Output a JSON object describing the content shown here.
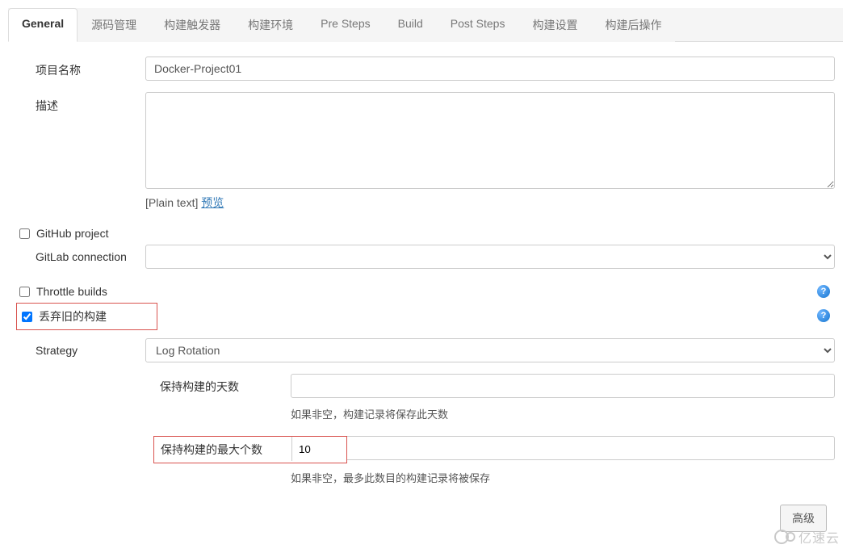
{
  "tabs": [
    {
      "label": "General",
      "active": true
    },
    {
      "label": "源码管理",
      "active": false
    },
    {
      "label": "构建触发器",
      "active": false
    },
    {
      "label": "构建环境",
      "active": false
    },
    {
      "label": "Pre Steps",
      "active": false
    },
    {
      "label": "Build",
      "active": false
    },
    {
      "label": "Post Steps",
      "active": false
    },
    {
      "label": "构建设置",
      "active": false
    },
    {
      "label": "构建后操作",
      "active": false
    }
  ],
  "form": {
    "project_name_label": "项目名称",
    "project_name_value": "Docker-Project01",
    "description_label": "描述",
    "description_value": "",
    "description_format": "[Plain text]",
    "description_preview": "预览",
    "github_project": {
      "label": "GitHub project",
      "checked": false
    },
    "gitlab_connection": {
      "label": "GitLab connection",
      "selected": ""
    },
    "throttle_builds": {
      "label": "Throttle builds",
      "checked": false
    },
    "discard_old_builds": {
      "label": "丢弃旧的构建",
      "checked": true
    },
    "strategy": {
      "label": "Strategy",
      "selected": "Log Rotation"
    },
    "days_to_keep": {
      "label": "保持构建的天数",
      "value": "",
      "hint": "如果非空，构建记录将保存此天数"
    },
    "max_count": {
      "label": "保持构建的最大个数",
      "value": "10",
      "hint": "如果非空，最多此数目的构建记录将被保存"
    },
    "advanced_button": "高级"
  },
  "watermark": "亿速云"
}
